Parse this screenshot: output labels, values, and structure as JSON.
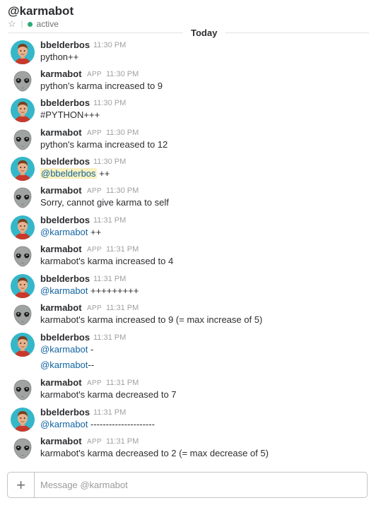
{
  "header": {
    "title": "@karmabot",
    "status": "active",
    "star_icon": "star-icon",
    "status_color": "#2bac76"
  },
  "day_divider": "Today",
  "messages": [
    {
      "author": "bbelderbos",
      "app": "",
      "time": "11:30 PM",
      "avatar": "human",
      "parts": [
        {
          "t": "python++",
          "k": "plain"
        }
      ]
    },
    {
      "author": "karmabot",
      "app": "APP",
      "time": "11:30 PM",
      "avatar": "bot",
      "parts": [
        {
          "t": "python's karma increased to 9",
          "k": "plain"
        }
      ]
    },
    {
      "author": "bbelderbos",
      "app": "",
      "time": "11:30 PM",
      "avatar": "human",
      "parts": [
        {
          "t": "#PYTHON+++",
          "k": "plain"
        }
      ]
    },
    {
      "author": "karmabot",
      "app": "APP",
      "time": "11:30 PM",
      "avatar": "bot",
      "parts": [
        {
          "t": "python's karma increased to 12",
          "k": "plain"
        }
      ]
    },
    {
      "author": "bbelderbos",
      "app": "",
      "time": "11:30 PM",
      "avatar": "human",
      "parts": [
        {
          "t": "@bbelderbos",
          "k": "mention-self"
        },
        {
          "t": " ++",
          "k": "plain"
        }
      ]
    },
    {
      "author": "karmabot",
      "app": "APP",
      "time": "11:30 PM",
      "avatar": "bot",
      "parts": [
        {
          "t": "Sorry, cannot give karma to self",
          "k": "plain"
        }
      ]
    },
    {
      "author": "bbelderbos",
      "app": "",
      "time": "11:31 PM",
      "avatar": "human",
      "parts": [
        {
          "t": "@karmabot",
          "k": "mention"
        },
        {
          "t": " ++",
          "k": "plain"
        }
      ]
    },
    {
      "author": "karmabot",
      "app": "APP",
      "time": "11:31 PM",
      "avatar": "bot",
      "parts": [
        {
          "t": "karmabot's karma increased to 4",
          "k": "plain"
        }
      ]
    },
    {
      "author": "bbelderbos",
      "app": "",
      "time": "11:31 PM",
      "avatar": "human",
      "parts": [
        {
          "t": "@karmabot",
          "k": "mention"
        },
        {
          "t": " +++++++++",
          "k": "plain"
        }
      ]
    },
    {
      "author": "karmabot",
      "app": "APP",
      "time": "11:31 PM",
      "avatar": "bot",
      "parts": [
        {
          "t": "karmabot's karma increased to 9 (= max increase of 5)",
          "k": "plain"
        }
      ]
    },
    {
      "author": "bbelderbos",
      "app": "",
      "time": "11:31 PM",
      "avatar": "human",
      "parts": [
        {
          "t": "@karmabot",
          "k": "mention"
        },
        {
          "t": " -",
          "k": "plain"
        }
      ],
      "extra": [
        {
          "t": "@karmabot",
          "k": "mention"
        },
        {
          "t": "--",
          "k": "plain"
        }
      ]
    },
    {
      "author": "karmabot",
      "app": "APP",
      "time": "11:31 PM",
      "avatar": "bot",
      "parts": [
        {
          "t": "karmabot's karma decreased to 7",
          "k": "plain"
        }
      ]
    },
    {
      "author": "bbelderbos",
      "app": "",
      "time": "11:31 PM",
      "avatar": "human",
      "parts": [
        {
          "t": "@karmabot",
          "k": "mention"
        },
        {
          "t": " ---------------------",
          "k": "plain"
        }
      ]
    },
    {
      "author": "karmabot",
      "app": "APP",
      "time": "11:31 PM",
      "avatar": "bot",
      "parts": [
        {
          "t": "karmabot's karma decreased to 2 (= max decrease of 5)",
          "k": "plain"
        }
      ]
    }
  ],
  "composer": {
    "placeholder": "Message @karmabot",
    "add_icon": "plus-icon",
    "add_label": "+"
  }
}
